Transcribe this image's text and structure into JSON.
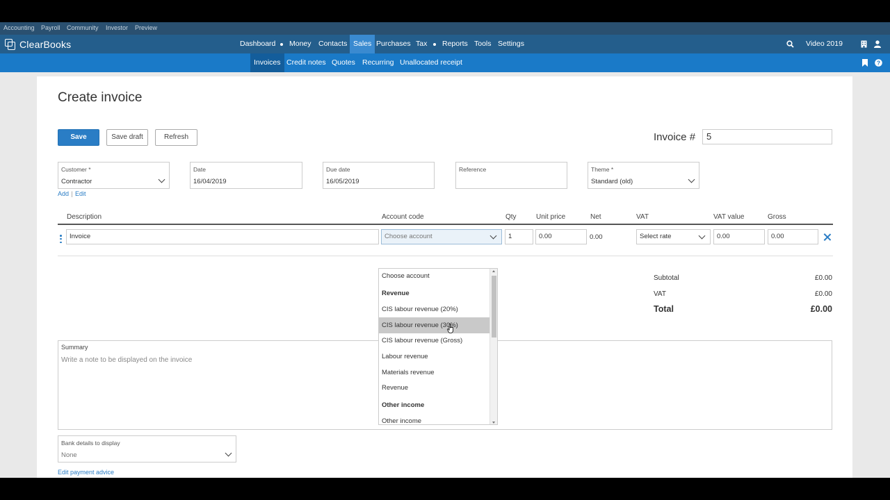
{
  "util_links": [
    "Accounting",
    "Payroll",
    "Community",
    "Investor",
    "Preview"
  ],
  "brand": {
    "name": "ClearBooks"
  },
  "main_nav": [
    "Dashboard",
    "Money",
    "Contacts",
    "Sales",
    "Purchases",
    "Tax",
    "Reports",
    "Tools",
    "Settings"
  ],
  "main_nav_active": "Sales",
  "account": {
    "company": "Video 2019"
  },
  "sub_nav": [
    "Invoices",
    "Credit notes",
    "Quotes",
    "Recurring",
    "Unallocated receipt"
  ],
  "sub_nav_active": "Invoices",
  "page": {
    "title": "Create invoice"
  },
  "actions": {
    "save": "Save",
    "save_draft": "Save draft",
    "refresh": "Refresh"
  },
  "invoice_number": {
    "label": "Invoice #",
    "value": "5"
  },
  "fields": {
    "customer": {
      "label": "Customer *",
      "value": "Contractor"
    },
    "date": {
      "label": "Date",
      "value": "16/04/2019"
    },
    "due_date": {
      "label": "Due date",
      "value": "16/05/2019"
    },
    "reference": {
      "label": "Reference",
      "value": ""
    },
    "theme": {
      "label": "Theme *",
      "value": "Standard (old)"
    }
  },
  "customer_links": {
    "add": "Add",
    "separator": "|",
    "edit": "Edit"
  },
  "line_columns": {
    "description": "Description",
    "account_code": "Account code",
    "qty": "Qty",
    "unit_price": "Unit price",
    "net": "Net",
    "vat": "VAT",
    "vat_value": "VAT value",
    "gross": "Gross"
  },
  "line_item": {
    "description": "Invoice",
    "account_code_placeholder": "Choose account",
    "qty": "1",
    "unit_price": "0.00",
    "net": "0.00",
    "vat_placeholder": "Select rate",
    "vat_value": "0.00",
    "gross": "0.00"
  },
  "account_dropdown": {
    "items": [
      {
        "label": "Choose account",
        "type": "option"
      },
      {
        "label": "Revenue",
        "type": "group"
      },
      {
        "label": "CIS labour revenue (20%)",
        "type": "option"
      },
      {
        "label": "CIS labour revenue (30%)",
        "type": "option",
        "hovered": true
      },
      {
        "label": "CIS labour revenue (Gross)",
        "type": "option"
      },
      {
        "label": "Labour revenue",
        "type": "option"
      },
      {
        "label": "Materials revenue",
        "type": "option"
      },
      {
        "label": "Revenue",
        "type": "option"
      },
      {
        "label": "Other income",
        "type": "group"
      },
      {
        "label": "Other income",
        "type": "option"
      }
    ]
  },
  "totals": {
    "subtotal_label": "Subtotal",
    "subtotal": "£0.00",
    "vat_label": "VAT",
    "vat": "£0.00",
    "total_label": "Total",
    "total": "£0.00"
  },
  "summary": {
    "label": "Summary",
    "placeholder": "Write a note to be displayed on the invoice"
  },
  "bank_details": {
    "label": "Bank details to display",
    "value": "None"
  },
  "payment_advice_link": "Edit payment advice"
}
